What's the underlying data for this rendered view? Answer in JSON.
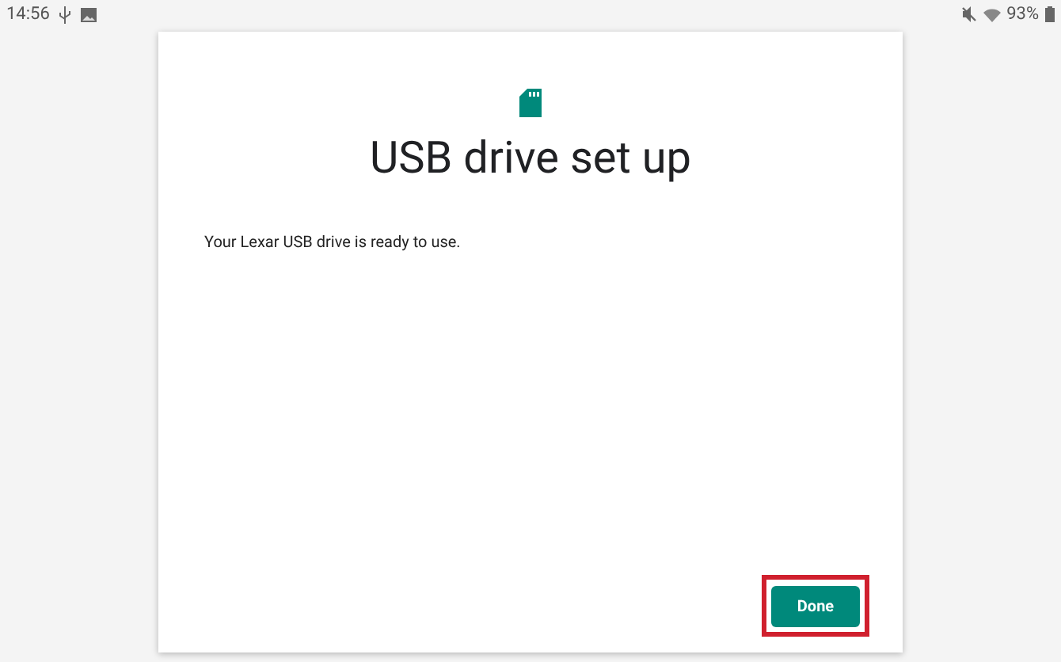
{
  "status_bar": {
    "time": "14:56",
    "battery": "93%"
  },
  "dialog": {
    "title": "USB drive set up",
    "message": "Your Lexar USB drive is ready to use.",
    "button": {
      "label": "Done",
      "highlighted": true
    }
  }
}
